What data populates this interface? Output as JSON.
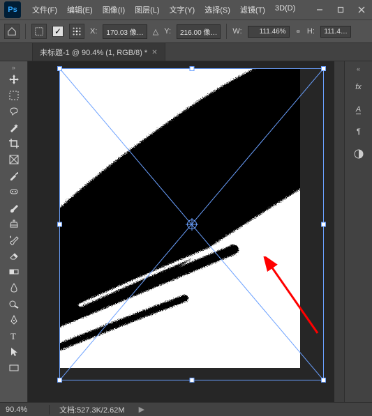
{
  "menu": {
    "file": "文件(F)",
    "edit": "编辑(E)",
    "image": "图像(I)",
    "layer": "图层(L)",
    "type": "文字(Y)",
    "select": "选择(S)",
    "filter": "滤镜(T)",
    "three_d": "3D(D)"
  },
  "options": {
    "x_label": "X:",
    "x_value": "170.03 像…",
    "y_label": "Y:",
    "y_value": "216.00 像…",
    "w_label": "W:",
    "w_value": "111.46%",
    "h_label": "H:",
    "h_value": "111.4…"
  },
  "tab": {
    "title": "未标题-1 @ 90.4% (1, RGB/8) *"
  },
  "status": {
    "zoom": "90.4%",
    "doc_label": "文档:",
    "doc_value": "527.3K/2.62M"
  },
  "right_panel": {
    "fx": "fx",
    "char": "A",
    "para": "¶"
  }
}
